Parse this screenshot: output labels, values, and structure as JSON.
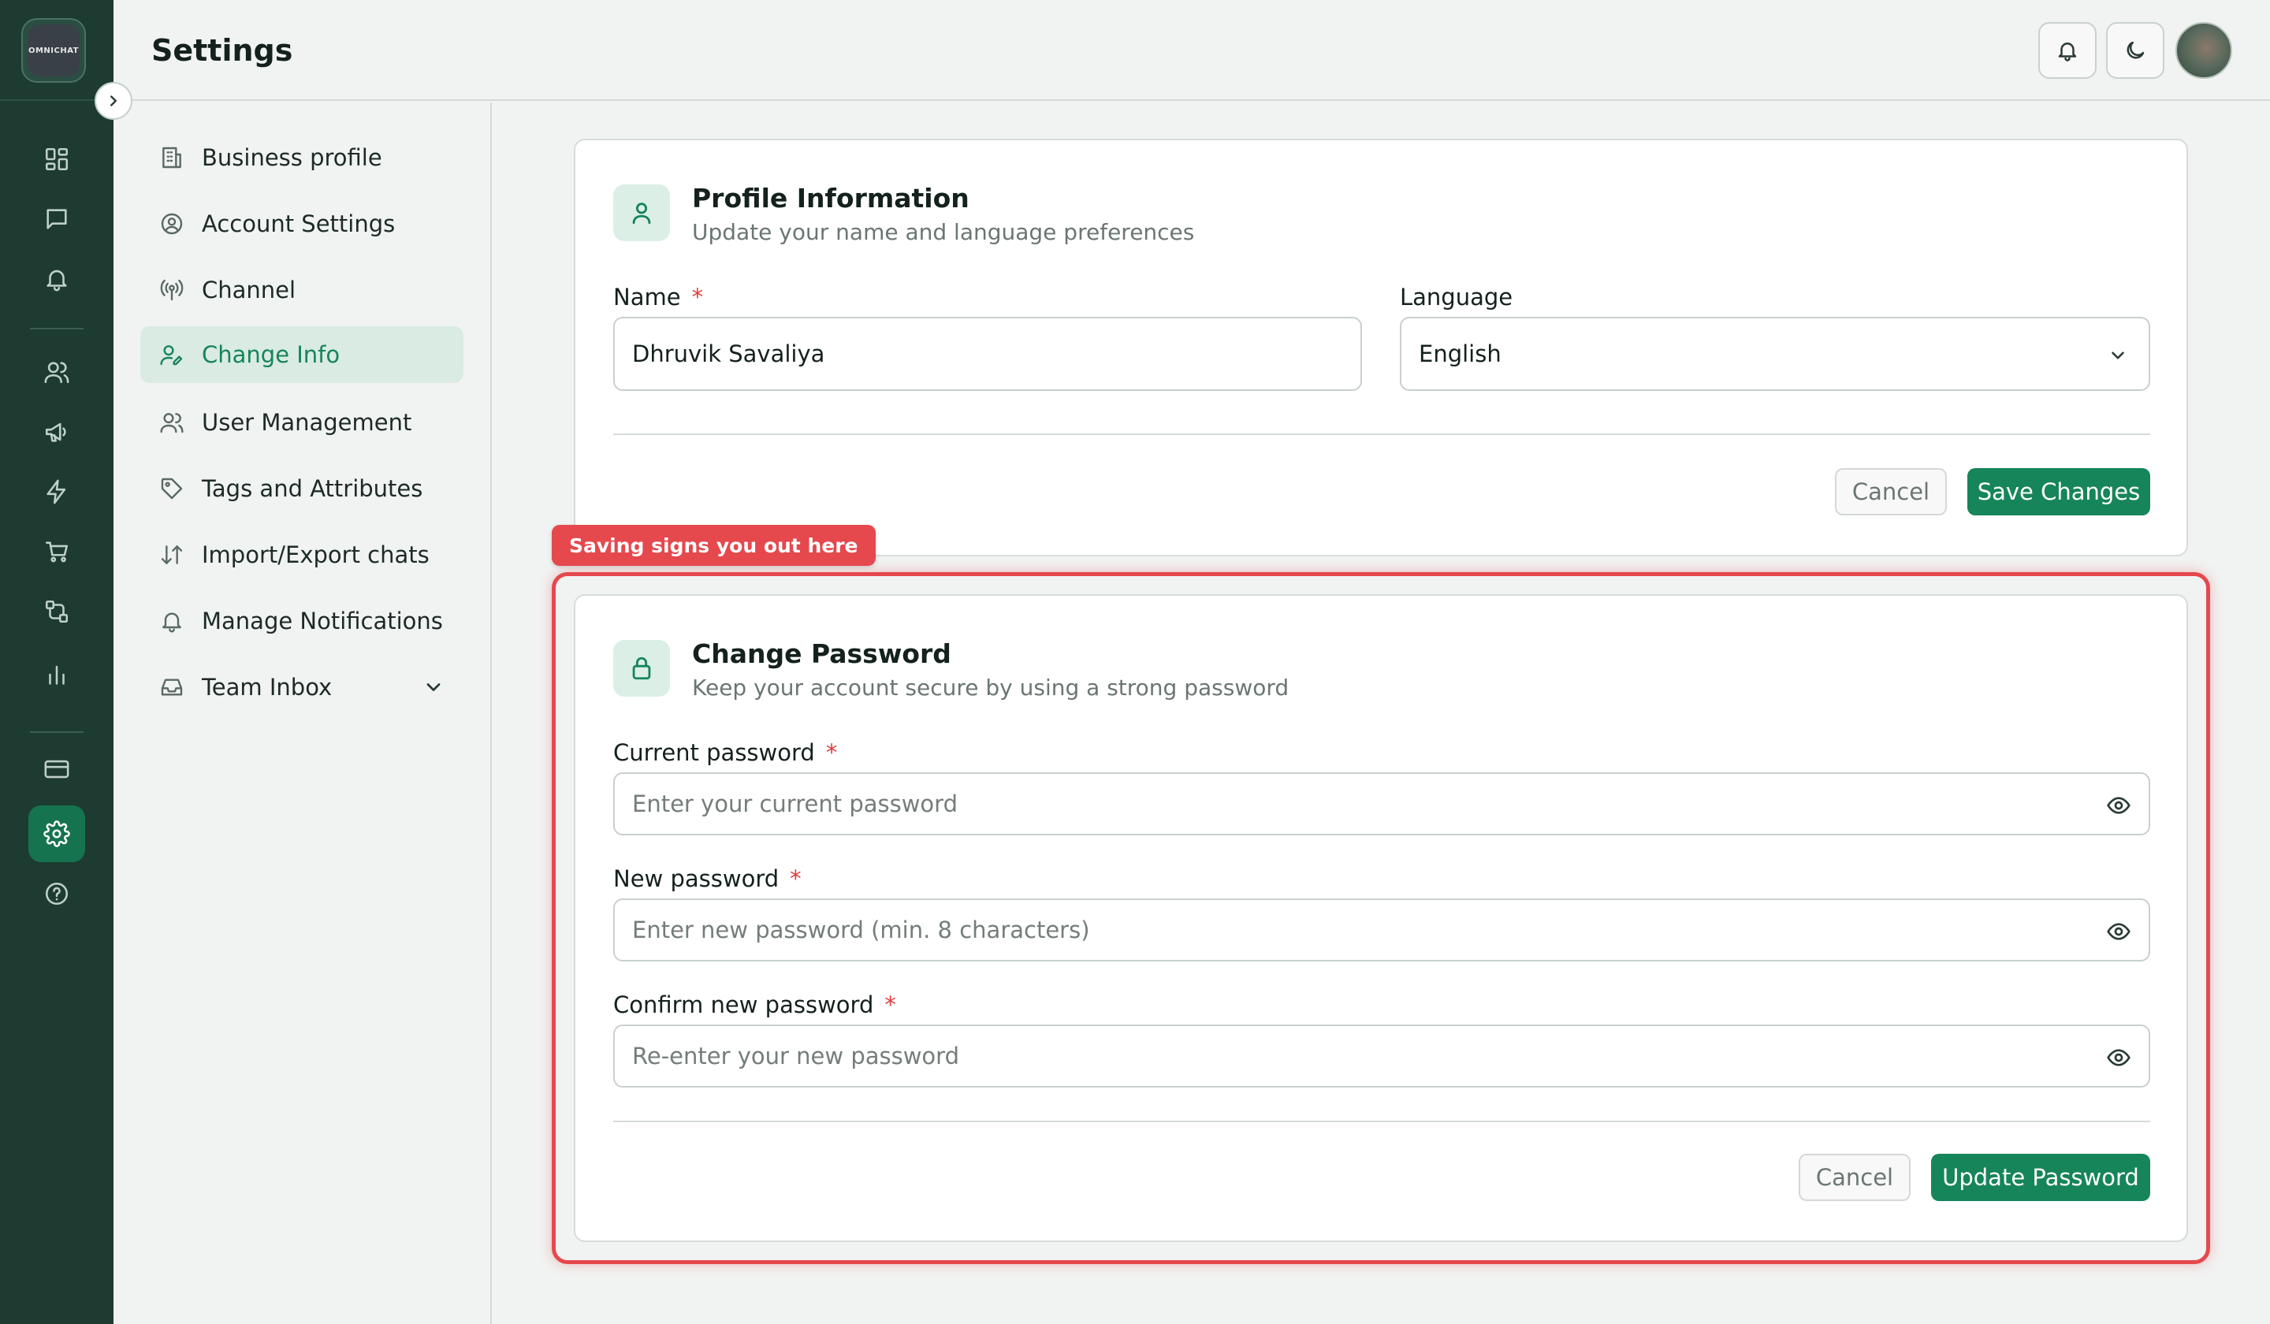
{
  "app": {
    "logo_text": "OMNICHAT"
  },
  "header": {
    "title": "Settings"
  },
  "rail": {
    "icons": [
      "dashboard-icon",
      "chat-icon",
      "bell-icon",
      "users-icon",
      "megaphone-icon",
      "lightning-icon",
      "cart-icon",
      "flow-icon",
      "chart-icon",
      "card-icon",
      "gear-icon",
      "help-icon"
    ],
    "active": "gear-icon"
  },
  "settings_nav": {
    "items": [
      {
        "label": "Business profile",
        "icon": "building-icon"
      },
      {
        "label": "Account Settings",
        "icon": "user-circle-icon"
      },
      {
        "label": "Channel",
        "icon": "broadcast-icon"
      },
      {
        "label": "Change Info",
        "icon": "user-edit-icon",
        "active": true
      },
      {
        "label": "User Management",
        "icon": "users-icon"
      },
      {
        "label": "Tags and Attributes",
        "icon": "tag-icon"
      },
      {
        "label": "Import/Export chats",
        "icon": "arrows-updown-icon"
      },
      {
        "label": "Manage Notifications",
        "icon": "bell-icon"
      },
      {
        "label": "Team Inbox",
        "icon": "inbox-icon",
        "expandable": true
      }
    ]
  },
  "profile_card": {
    "title": "Profile Information",
    "subtitle": "Update your name and language preferences",
    "name_label": "Name",
    "name_required": "*",
    "name_value": "Dhruvik Savaliya",
    "language_label": "Language",
    "language_value": "English",
    "cancel_label": "Cancel",
    "save_label": "Save Changes"
  },
  "annotation": {
    "text": "Saving signs you out here",
    "color": "#e5484d"
  },
  "password_card": {
    "title": "Change Password",
    "subtitle": "Keep your account secure by using a strong password",
    "current_label": "Current password",
    "current_placeholder": "Enter your current password",
    "new_label": "New password",
    "new_placeholder": "Enter new password (min. 8 characters)",
    "confirm_label": "Confirm new password",
    "confirm_placeholder": "Re-enter your new password",
    "required": "*",
    "cancel_label": "Cancel",
    "update_label": "Update Password"
  },
  "colors": {
    "accent": "#16855a",
    "rail_bg": "#1d3b30",
    "danger": "#e5484d"
  }
}
